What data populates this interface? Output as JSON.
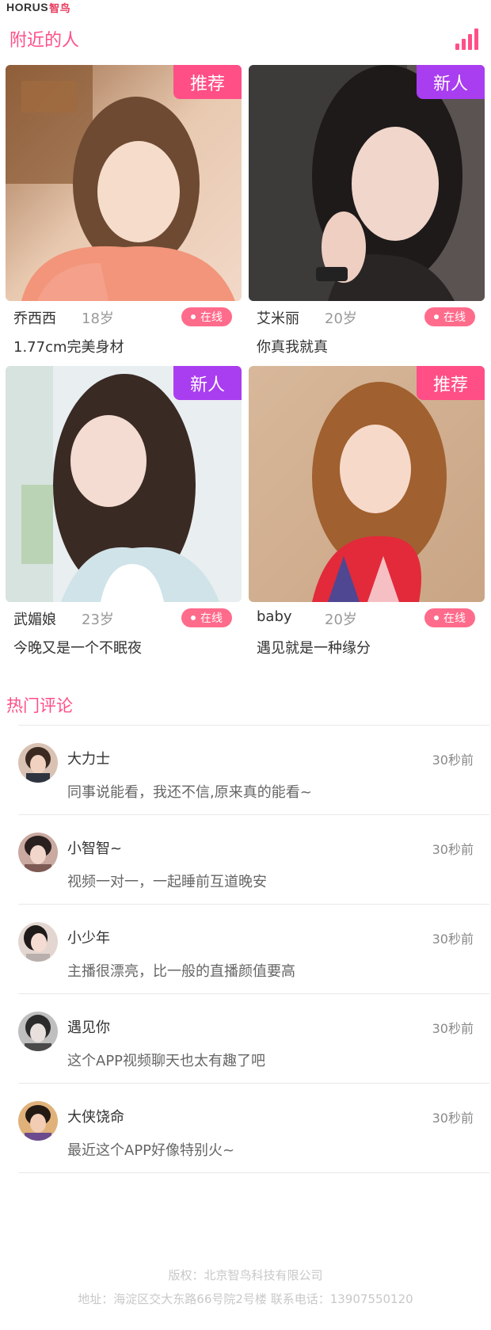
{
  "app": {
    "logo_text": "HORUS",
    "logo_cn": "智鸟"
  },
  "nearby": {
    "title": "附近的人",
    "signal_icon": "signal-bars-icon",
    "accent_color": "#ff4f86",
    "cards": [
      {
        "tag": "推荐",
        "name": "乔西西",
        "age": "18岁",
        "status": "在线",
        "motto": "1.77cm完美身材"
      },
      {
        "tag": "新人",
        "name": "艾米丽",
        "age": "20岁",
        "status": "在线",
        "motto": "你真我就真"
      },
      {
        "tag": "新人",
        "name": "武媚娘",
        "age": "23岁",
        "status": "在线",
        "motto": "今晚又是一个不眠夜"
      },
      {
        "tag": "推荐",
        "name": "baby",
        "age": "20岁",
        "status": "在线",
        "motto": "遇见就是一种缘分"
      }
    ]
  },
  "hot_comments": {
    "title": "热门评论",
    "items": [
      {
        "name": "大力士",
        "time": "30秒前",
        "text": "同事说能看，我还不信,原来真的能看~"
      },
      {
        "name": "小智智~",
        "time": "30秒前",
        "text": "视频一对一，一起睡前互道晚安"
      },
      {
        "name": "小少年",
        "time": "30秒前",
        "text": "主播很漂亮，比一般的直播颜值要高"
      },
      {
        "name": "遇见你",
        "time": "30秒前",
        "text": "这个APP视频聊天也太有趣了吧"
      },
      {
        "name": "大侠饶命",
        "time": "30秒前",
        "text": "最近这个APP好像特别火~"
      }
    ]
  },
  "footer": {
    "copyright": "版权：北京智鸟科技有限公司",
    "address": "地址：海淀区交大东路66号院2号楼 联系电话：13907550120"
  },
  "colors": {
    "tag_recommend": "#ff4f86",
    "tag_new": "#a93df0",
    "online_badge": "#ff6b8b"
  }
}
